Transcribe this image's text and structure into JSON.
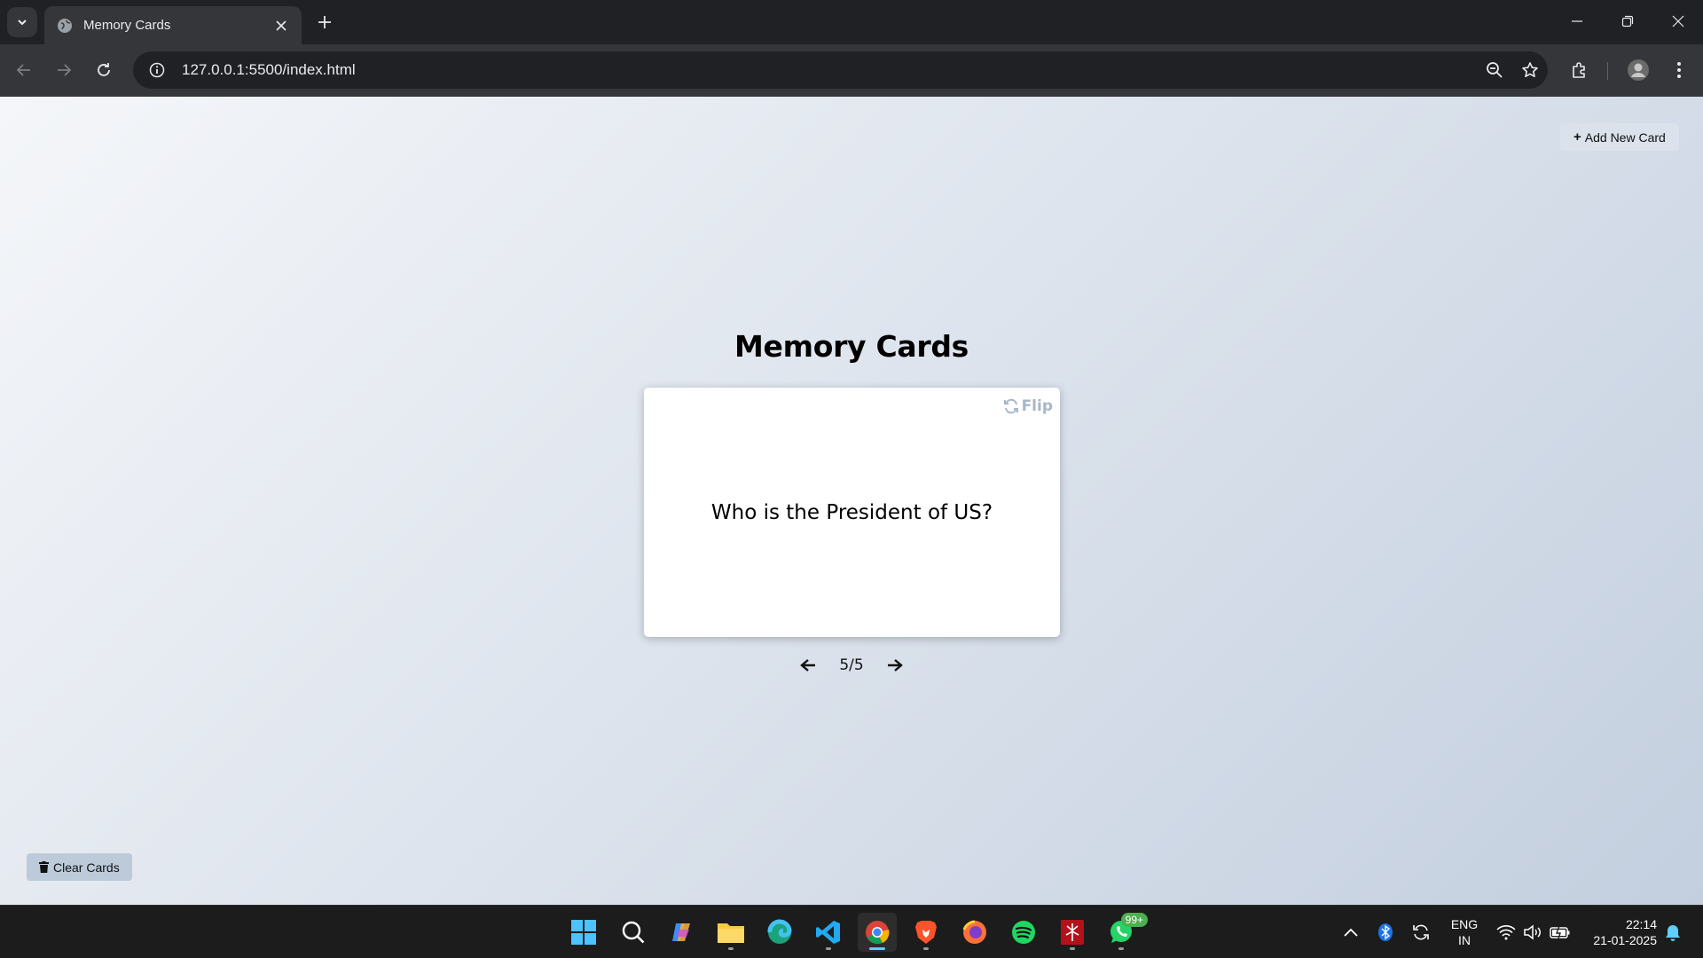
{
  "browser": {
    "tab_title": "Memory Cards",
    "url": "127.0.0.1:5500/index.html"
  },
  "page": {
    "add_button_label": "Add New Card",
    "heading": "Memory Cards",
    "flip_label": "Flip",
    "question": "Who is the President of US?",
    "counter": "5/5",
    "clear_button_label": "Clear Cards"
  },
  "taskbar": {
    "whatsapp_badge": "99+",
    "language_top": "ENG",
    "language_bottom": "IN",
    "time": "22:14",
    "date": "21-01-2025"
  }
}
